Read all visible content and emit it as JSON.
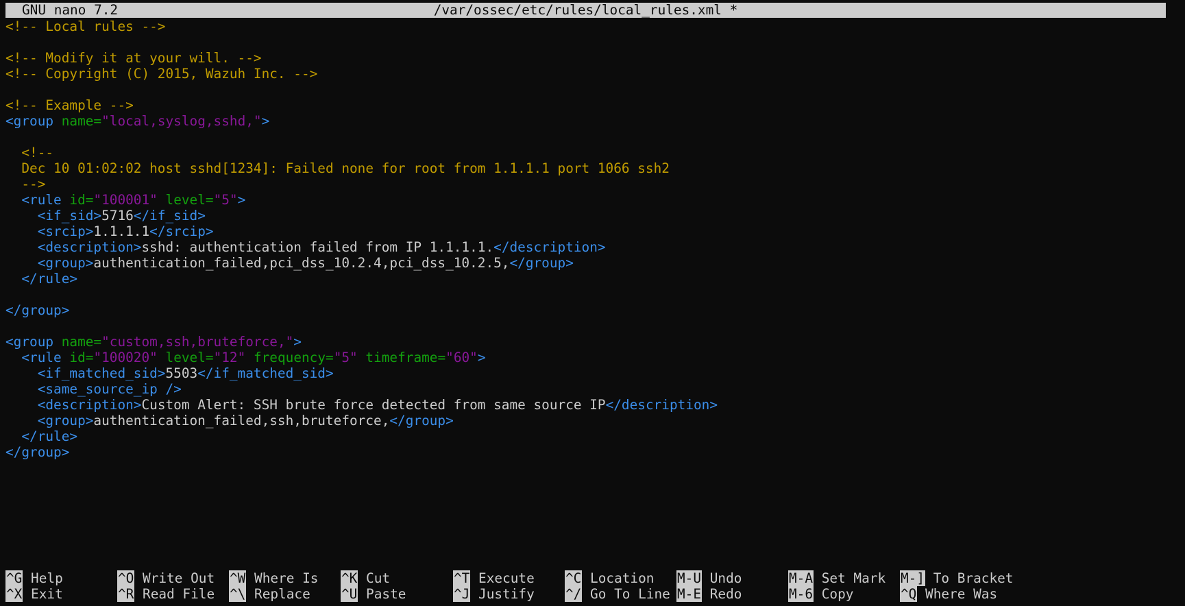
{
  "titlebar": {
    "app": "GNU nano 7.2",
    "file": "/var/ossec/etc/rules/local_rules.xml *"
  },
  "editor_lines": [
    [
      {
        "t": "<!-- Local rules -->",
        "c": "comment"
      }
    ],
    [],
    [
      {
        "t": "<!-- Modify it at your will. -->",
        "c": "comment"
      }
    ],
    [
      {
        "t": "<!-- Copyright (C) 2015, Wazuh Inc. -->",
        "c": "comment"
      }
    ],
    [],
    [
      {
        "t": "<!-- Example -->",
        "c": "comment"
      }
    ],
    [
      {
        "t": "<group ",
        "c": "tag"
      },
      {
        "t": "name=",
        "c": "attr"
      },
      {
        "t": "\"local,syslog,sshd,\"",
        "c": "val"
      },
      {
        "t": ">",
        "c": "tag"
      }
    ],
    [],
    [
      {
        "t": "  <!--",
        "c": "comment"
      }
    ],
    [
      {
        "t": "  Dec 10 01:02:02 host sshd[1234]: Failed none for root from 1.1.1.1 port 1066 ssh2",
        "c": "comment"
      }
    ],
    [
      {
        "t": "  -->",
        "c": "comment"
      }
    ],
    [
      {
        "t": "  <rule ",
        "c": "tag"
      },
      {
        "t": "id=",
        "c": "attr"
      },
      {
        "t": "\"100001\"",
        "c": "val"
      },
      {
        "t": " level=",
        "c": "attr"
      },
      {
        "t": "\"5\"",
        "c": "val"
      },
      {
        "t": ">",
        "c": "tag"
      }
    ],
    [
      {
        "t": "    <if_sid>",
        "c": "tag"
      },
      {
        "t": "5716",
        "c": "text"
      },
      {
        "t": "</if_sid>",
        "c": "tag"
      }
    ],
    [
      {
        "t": "    <srcip>",
        "c": "tag"
      },
      {
        "t": "1.1.1.1",
        "c": "text"
      },
      {
        "t": "</srcip>",
        "c": "tag"
      }
    ],
    [
      {
        "t": "    <description>",
        "c": "tag"
      },
      {
        "t": "sshd: authentication failed from IP 1.1.1.1.",
        "c": "text"
      },
      {
        "t": "</description>",
        "c": "tag"
      }
    ],
    [
      {
        "t": "    <group>",
        "c": "tag"
      },
      {
        "t": "authentication_failed,pci_dss_10.2.4,pci_dss_10.2.5,",
        "c": "text"
      },
      {
        "t": "</group>",
        "c": "tag"
      }
    ],
    [
      {
        "t": "  </rule>",
        "c": "tag"
      }
    ],
    [],
    [
      {
        "t": "</group>",
        "c": "tag"
      }
    ],
    [],
    [
      {
        "t": "<group ",
        "c": "tag"
      },
      {
        "t": "name=",
        "c": "attr"
      },
      {
        "t": "\"custom,ssh,bruteforce,\"",
        "c": "val"
      },
      {
        "t": ">",
        "c": "tag"
      }
    ],
    [
      {
        "t": "  <rule ",
        "c": "tag"
      },
      {
        "t": "id=",
        "c": "attr"
      },
      {
        "t": "\"100020\"",
        "c": "val"
      },
      {
        "t": " level=",
        "c": "attr"
      },
      {
        "t": "\"12\"",
        "c": "val"
      },
      {
        "t": " frequency=",
        "c": "attr"
      },
      {
        "t": "\"5\"",
        "c": "val"
      },
      {
        "t": " timeframe=",
        "c": "attr"
      },
      {
        "t": "\"60\"",
        "c": "val"
      },
      {
        "t": ">",
        "c": "tag"
      }
    ],
    [
      {
        "t": "    <if_matched_sid>",
        "c": "tag"
      },
      {
        "t": "5503",
        "c": "text"
      },
      {
        "t": "</if_matched_sid>",
        "c": "tag"
      }
    ],
    [
      {
        "t": "    <same_source_ip />",
        "c": "tag"
      }
    ],
    [
      {
        "t": "    <description>",
        "c": "tag"
      },
      {
        "t": "Custom Alert: SSH brute force detected from same source IP",
        "c": "text"
      },
      {
        "t": "</description>",
        "c": "tag"
      }
    ],
    [
      {
        "t": "    <group>",
        "c": "tag"
      },
      {
        "t": "authentication_failed,ssh,bruteforce,",
        "c": "text"
      },
      {
        "t": "</group>",
        "c": "tag"
      }
    ],
    [
      {
        "t": "  </rule>",
        "c": "tag"
      }
    ],
    [
      {
        "t": "</group>",
        "c": "tag"
      }
    ]
  ],
  "shortcuts": {
    "row1": [
      {
        "key": "^G",
        "label": "Help"
      },
      {
        "key": "^O",
        "label": "Write Out"
      },
      {
        "key": "^W",
        "label": "Where Is"
      },
      {
        "key": "^K",
        "label": "Cut"
      },
      {
        "key": "^T",
        "label": "Execute"
      },
      {
        "key": "^C",
        "label": "Location"
      },
      {
        "key": "M-U",
        "label": "Undo"
      },
      {
        "key": "M-A",
        "label": "Set Mark"
      },
      {
        "key": "M-]",
        "label": "To Bracket"
      }
    ],
    "row2": [
      {
        "key": "^X",
        "label": "Exit"
      },
      {
        "key": "^R",
        "label": "Read File"
      },
      {
        "key": "^\\",
        "label": "Replace"
      },
      {
        "key": "^U",
        "label": "Paste"
      },
      {
        "key": "^J",
        "label": "Justify"
      },
      {
        "key": "^/",
        "label": "Go To Line"
      },
      {
        "key": "M-E",
        "label": "Redo"
      },
      {
        "key": "M-6",
        "label": "Copy"
      },
      {
        "key": "^Q",
        "label": "Where Was"
      }
    ]
  },
  "colors": {
    "background": "#0c0c0c",
    "comment": "#c19c00",
    "tag": "#3b8eea",
    "attr": "#13a10e",
    "value": "#881798",
    "text": "#cccccc",
    "titlebar_bg": "#cccccc"
  }
}
